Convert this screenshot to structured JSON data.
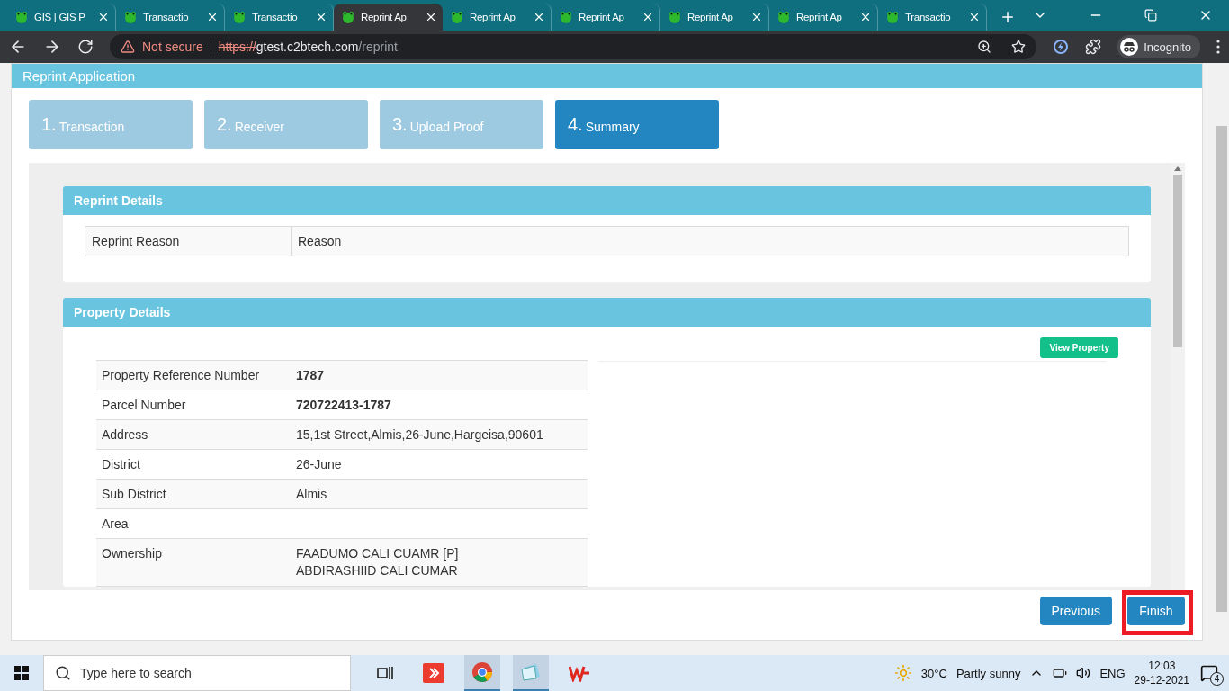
{
  "browser": {
    "tabs": [
      {
        "title": "GIS | GIS P",
        "selected": false
      },
      {
        "title": "Transactio",
        "selected": false
      },
      {
        "title": "Transactio",
        "selected": false
      },
      {
        "title": "Reprint Ap",
        "selected": true
      },
      {
        "title": "Reprint Ap",
        "selected": false
      },
      {
        "title": "Reprint Ap",
        "selected": false
      },
      {
        "title": "Reprint Ap",
        "selected": false
      },
      {
        "title": "Reprint Ap",
        "selected": false
      },
      {
        "title": "Transactio",
        "selected": false
      }
    ],
    "security": "Not secure",
    "url_scheme": "https://",
    "url_host": "gtest.c2btech.com",
    "url_path": "/reprint",
    "profile": "Incognito"
  },
  "page": {
    "title": "Reprint Application",
    "steps": [
      {
        "number": "1.",
        "label": "Transaction",
        "selected": false
      },
      {
        "number": "2.",
        "label": "Receiver",
        "selected": false
      },
      {
        "number": "3.",
        "label": "Upload Proof",
        "selected": false
      },
      {
        "number": "4.",
        "label": "Summary",
        "selected": true
      }
    ],
    "reprint_details": {
      "title": "Reprint Details",
      "rows": [
        {
          "label": "Reprint Reason",
          "value": "Reason"
        }
      ]
    },
    "property_details": {
      "title": "Property Details",
      "button": "View Property",
      "rows": [
        {
          "label": "Property Reference Number",
          "value": [
            "1787"
          ],
          "bold": true
        },
        {
          "label": "Parcel Number",
          "value": [
            "720722413-1787"
          ],
          "bold": true
        },
        {
          "label": "Address",
          "value": [
            "15,1st Street,Almis,26-June,Hargeisa,90601"
          ],
          "bold": false
        },
        {
          "label": "District",
          "value": [
            "26-June"
          ],
          "bold": false
        },
        {
          "label": "Sub District",
          "value": [
            "Almis"
          ],
          "bold": false
        },
        {
          "label": "Area",
          "value": []
        },
        {
          "label": "Ownership",
          "value": [
            "FAADUMO CALI CUAMR [P]",
            "ABDIRASHIID CALI CUMAR"
          ],
          "bold": false
        }
      ]
    },
    "buttons": [
      {
        "label": "Previous",
        "highlighted": false
      },
      {
        "label": "Finish",
        "highlighted": true
      }
    ]
  },
  "taskbar": {
    "search_placeholder": "Type here to search",
    "temperature": "30°C",
    "weather": "Partly sunny",
    "language": "ENG",
    "time": "12:03",
    "date": "29-12-2021",
    "notifications": "4"
  }
}
